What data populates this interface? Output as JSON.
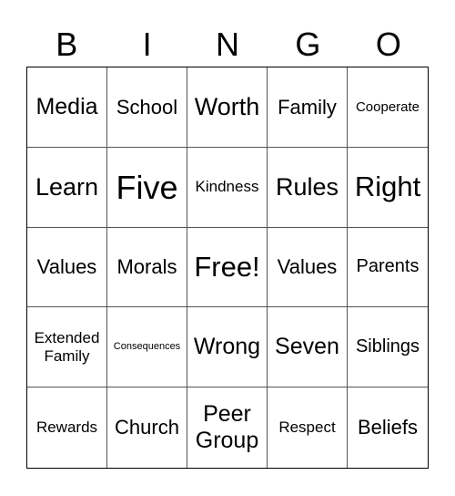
{
  "header": {
    "letters": [
      "B",
      "I",
      "N",
      "G",
      "O"
    ]
  },
  "grid": {
    "rows": [
      [
        {
          "text": "Media",
          "size": "fs-l"
        },
        {
          "text": "School",
          "size": "fs-ml"
        },
        {
          "text": "Worth",
          "size": "fs-xl"
        },
        {
          "text": "Family",
          "size": "fs-ml"
        },
        {
          "text": "Cooperate",
          "size": "fs-s"
        }
      ],
      [
        {
          "text": "Learn",
          "size": "fs-xl"
        },
        {
          "text": "Five",
          "size": "fs-xxxl"
        },
        {
          "text": "Kindness",
          "size": "fs-sm"
        },
        {
          "text": "Rules",
          "size": "fs-xl"
        },
        {
          "text": "Right",
          "size": "fs-xxl"
        }
      ],
      [
        {
          "text": "Values",
          "size": "fs-ml"
        },
        {
          "text": "Morals",
          "size": "fs-ml"
        },
        {
          "text": "Free!",
          "size": "fs-xxl"
        },
        {
          "text": "Values",
          "size": "fs-ml"
        },
        {
          "text": "Parents",
          "size": "fs-m"
        }
      ],
      [
        {
          "text": "Extended\nFamily",
          "size": "fs-sm"
        },
        {
          "text": "Consequences",
          "size": "fs-xs"
        },
        {
          "text": "Wrong",
          "size": "fs-l"
        },
        {
          "text": "Seven",
          "size": "fs-l"
        },
        {
          "text": "Siblings",
          "size": "fs-m"
        }
      ],
      [
        {
          "text": "Rewards",
          "size": "fs-sm"
        },
        {
          "text": "Church",
          "size": "fs-ml"
        },
        {
          "text": "Peer\nGroup",
          "size": "fs-l"
        },
        {
          "text": "Respect",
          "size": "fs-sm"
        },
        {
          "text": "Beliefs",
          "size": "fs-ml"
        }
      ]
    ]
  }
}
